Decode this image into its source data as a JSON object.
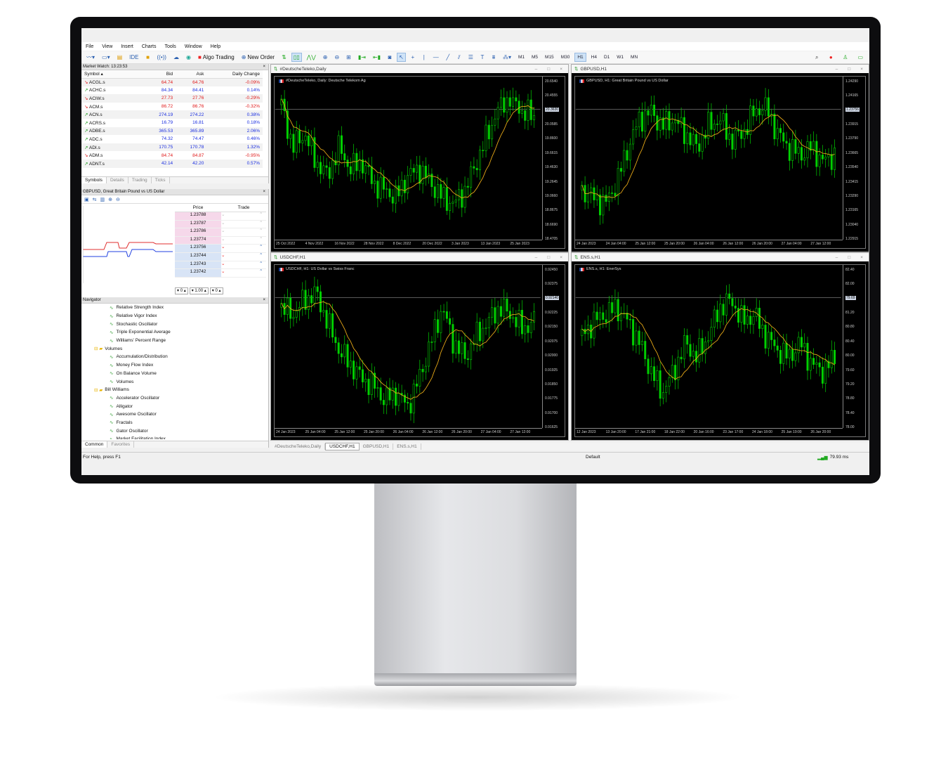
{
  "menu": [
    "File",
    "View",
    "Insert",
    "Charts",
    "Tools",
    "Window",
    "Help"
  ],
  "toolbar": {
    "ide": "IDE",
    "algo": "Algo Trading",
    "new_order": "New Order",
    "timeframes": [
      "M1",
      "M5",
      "M15",
      "M30",
      "H1",
      "H4",
      "D1",
      "W1",
      "MN"
    ],
    "active_tf": "H1"
  },
  "market_watch": {
    "title": "Market Watch: 13:23:53",
    "headers": [
      "Symbol",
      "Bid",
      "Ask",
      "Daily Change"
    ],
    "rows": [
      [
        "ACGL.s",
        "64.74",
        "64.76",
        "-0.09%",
        "down"
      ],
      [
        "ACHC.s",
        "84.34",
        "84.41",
        "0.14%",
        "up"
      ],
      [
        "ACIW.s",
        "27.73",
        "27.76",
        "-0.29%",
        "down"
      ],
      [
        "ACM.s",
        "86.72",
        "86.76",
        "-0.32%",
        "down"
      ],
      [
        "ACN.s",
        "274.19",
        "274.22",
        "0.38%",
        "up"
      ],
      [
        "ACRS.s",
        "16.79",
        "16.81",
        "0.18%",
        "up"
      ],
      [
        "ADBE.s",
        "365.53",
        "365.89",
        "2.06%",
        "up"
      ],
      [
        "ADC.s",
        "74.32",
        "74.47",
        "0.46%",
        "up"
      ],
      [
        "ADI.s",
        "170.75",
        "170.78",
        "1.32%",
        "up"
      ],
      [
        "ADM.s",
        "84.74",
        "84.87",
        "-0.95%",
        "down"
      ],
      [
        "ADNT.s",
        "42.14",
        "42.20",
        "0.57%",
        "up"
      ]
    ],
    "tabs": [
      "Symbols",
      "Details",
      "Trading",
      "Ticks"
    ]
  },
  "dom": {
    "title": "GBPUSD, Great Britain Pound vs US Dollar",
    "headers": [
      "Price",
      "Trade"
    ],
    "prices": [
      "1.23788",
      "1.23787",
      "1.23786",
      "1.23774",
      "1.23756",
      "1.23744",
      "1.23743",
      "1.23742"
    ],
    "lot": "1.00",
    "left_val": "0",
    "right_val": "0"
  },
  "navigator": {
    "title": "Navigator",
    "items": [
      {
        "t": "Relative Strength Index",
        "lvl": 2
      },
      {
        "t": "Relative Vigor Index",
        "lvl": 2
      },
      {
        "t": "Stochastic Oscillator",
        "lvl": 2
      },
      {
        "t": "Triple Exponential Average",
        "lvl": 2
      },
      {
        "t": "Williams' Percent Range",
        "lvl": 2
      },
      {
        "t": "Volumes",
        "lvl": 1
      },
      {
        "t": "Accumulation/Distribution",
        "lvl": 2
      },
      {
        "t": "Money Flow Index",
        "lvl": 2
      },
      {
        "t": "On Balance Volume",
        "lvl": 2
      },
      {
        "t": "Volumes",
        "lvl": 2
      },
      {
        "t": "Bill Williams",
        "lvl": 1
      },
      {
        "t": "Accelerator Oscillator",
        "lvl": 2
      },
      {
        "t": "Alligator",
        "lvl": 2
      },
      {
        "t": "Awesome Oscillator",
        "lvl": 2
      },
      {
        "t": "Fractals",
        "lvl": 2
      },
      {
        "t": "Gator Oscillator",
        "lvl": 2
      },
      {
        "t": "Market Facilitation Index",
        "lvl": 2
      }
    ],
    "tabs": [
      "Common",
      "Favorites"
    ]
  },
  "charts": [
    {
      "win": "#DeutscheTeleko,Daily",
      "label": "#DeutscheTeleko, Daily:  Deutsche Telekom Ag",
      "yticks": [
        "20.6540",
        "20.4555",
        "20.2570",
        "20.0585",
        "19.8600",
        "19.6615",
        "19.4630",
        "19.2645",
        "19.0660",
        "18.8675",
        "18.6690",
        "18.4705"
      ],
      "xticks": [
        "25 Oct 2022",
        "4 Nov 2022",
        "16 Nov 2022",
        "28 Nov 2022",
        "8 Dec 2022",
        "20 Dec 2022",
        "3 Jan 2023",
        "13 Jan 2023",
        "25 Jan 2023"
      ],
      "price": "20.3630"
    },
    {
      "win": "GBPUSD,H1",
      "label": "GBPUSD, H1:  Great Britain Pound vs US Dollar",
      "yticks": [
        "1.24290",
        "1.24165",
        "1.24040",
        "1.23915",
        "1.23790",
        "1.23665",
        "1.23540",
        "1.23415",
        "1.23290",
        "1.23165",
        "1.23040",
        "1.22915"
      ],
      "xticks": [
        "24 Jan 2023",
        "24 Jan 04:00",
        "25 Jan 12:00",
        "25 Jan 20:00",
        "26 Jan 04:00",
        "26 Jan 12:00",
        "26 Jan 20:00",
        "27 Jan 04:00",
        "27 Jan 12:00"
      ],
      "price": "1.23756"
    },
    {
      "win": "USDCHF,H1",
      "label": "USDCHF, H1:  US Dollar vs Swiss Franc",
      "yticks": [
        "0.92450",
        "0.92375",
        "0.92300",
        "0.92225",
        "0.92150",
        "0.92075",
        "0.92000",
        "0.91925",
        "0.91850",
        "0.91775",
        "0.91700",
        "0.91625"
      ],
      "xticks": [
        "24 Jan 2023",
        "25 Jan 04:00",
        "25 Jan 12:00",
        "25 Jan 20:00",
        "26 Jan 04:00",
        "26 Jan 12:00",
        "26 Jan 20:00",
        "27 Jan 04:00",
        "27 Jan 12:00"
      ],
      "price": "0.92140"
    },
    {
      "win": "ENS.s,H1",
      "label": "ENS.s, H1:  EnerSys",
      "yticks": [
        "82.40",
        "82.00",
        "81.60",
        "81.20",
        "80.80",
        "80.40",
        "80.00",
        "79.60",
        "79.20",
        "78.80",
        "78.40",
        "78.00"
      ],
      "xticks": [
        "12 Jan 2023",
        "13 Jan 20:00",
        "17 Jan 21:00",
        "18 Jan 22:00",
        "20 Jan 16:00",
        "23 Jan 17:00",
        "24 Jan 18:00",
        "25 Jan 19:00",
        "26 Jan 20:00"
      ],
      "price": "79.69"
    }
  ],
  "chart_tabs": [
    "#DeutscheTeleko,Daily",
    "USDCHF,H1",
    "GBPUSD,H1",
    "ENS.s,H1"
  ],
  "active_chart_tab": "USDCHF,H1",
  "status": {
    "help": "For Help, press F1",
    "profile": "Default",
    "ping": "79.93 ms"
  },
  "colors": {
    "bull": "#00dd00",
    "bear": "#00dd00",
    "ma": "#e6a817",
    "up": "#1a2ee0",
    "down": "#e01a1a"
  }
}
